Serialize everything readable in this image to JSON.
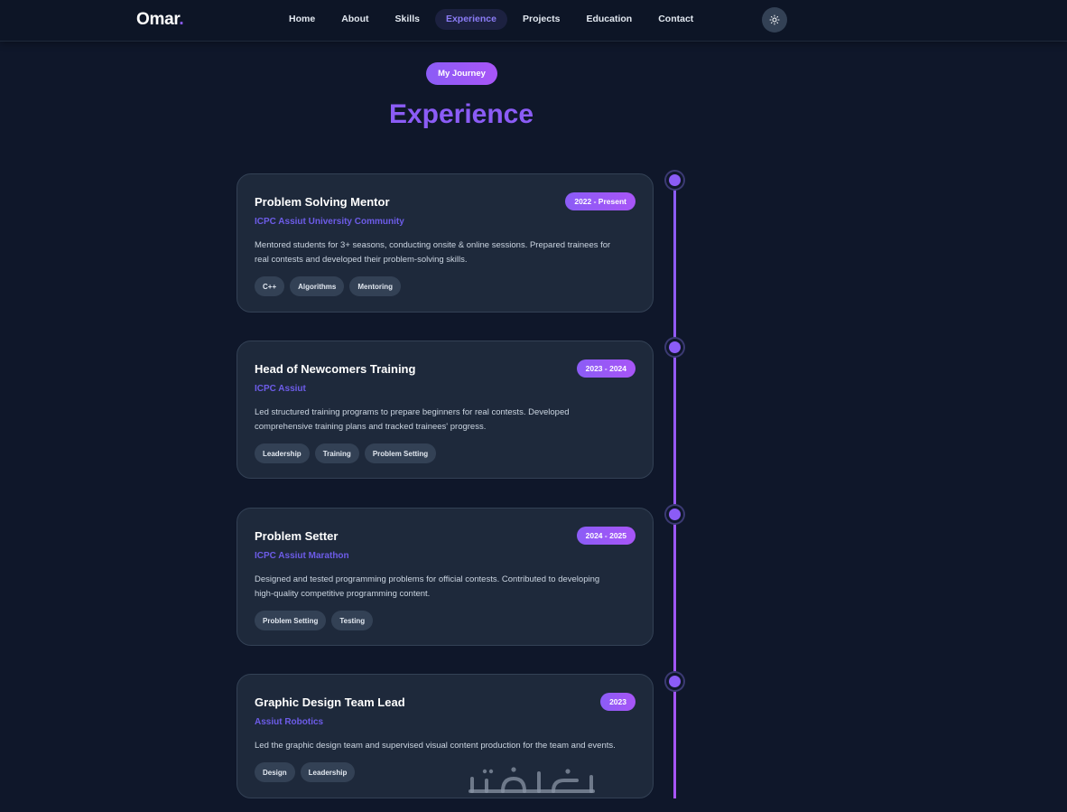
{
  "nav": {
    "logo": "Omar",
    "logo_dot": ".",
    "links": [
      {
        "label": "Home"
      },
      {
        "label": "About"
      },
      {
        "label": "Skills"
      },
      {
        "label": "Experience"
      },
      {
        "label": "Projects"
      },
      {
        "label": "Education"
      },
      {
        "label": "Contact"
      }
    ],
    "active_link": "Experience",
    "theme_icon": "sun-icon"
  },
  "section": {
    "badge": "My Journey",
    "title": "Experience"
  },
  "experiences": [
    {
      "title": "Problem Solving Mentor",
      "date": "2022 - Present",
      "org": "ICPC Assiut University Community",
      "desc_lines": [
        "Mentored students for 3+ seasons, conducting onsite & online sessions. Prepared trainees for",
        "real contests and developed their problem-solving skills."
      ],
      "tags": [
        "C++",
        "Algorithms",
        "Mentoring"
      ]
    },
    {
      "title": "Head of Newcomers Training",
      "date": "2023 - 2024",
      "org": "ICPC Assiut",
      "desc_lines": [
        "Led structured training programs to prepare beginners for real contests. Developed",
        "comprehensive training plans and tracked trainees' progress."
      ],
      "tags": [
        "Leadership",
        "Training",
        "Problem Setting"
      ]
    },
    {
      "title": "Problem Setter",
      "date": "2024 - 2025",
      "org": "ICPC Assiut Marathon",
      "desc_lines": [
        "Designed and tested programming problems for official contests. Contributed to developing",
        "high-quality competitive programming content."
      ],
      "tags": [
        "Problem Setting",
        "Testing"
      ]
    },
    {
      "title": "Graphic Design Team Lead",
      "date": "2023",
      "org": "Assiut Robotics",
      "desc_lines": [
        "Led the graphic design team and supervised visual content production for the team and events."
      ],
      "tags": [
        "Design",
        "Leadership"
      ]
    }
  ],
  "watermark": "خمسات",
  "colors": {
    "background": "#0f172a",
    "card": "#1e293b",
    "accent": "#8b5cf6",
    "accent_alt": "#a855f7",
    "org_text": "#6d5ce8"
  }
}
